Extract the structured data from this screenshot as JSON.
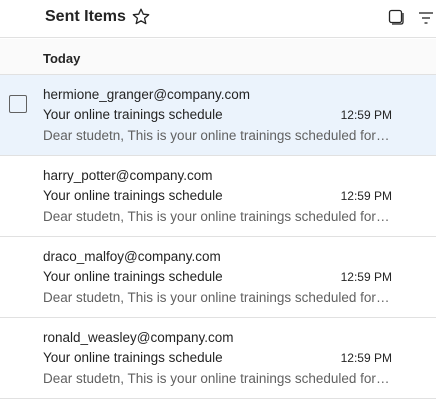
{
  "header": {
    "title": "Sent Items",
    "favorite_icon": "star-outline-icon",
    "select_icon": "select-mode-icon",
    "filter_icon": "filter-icon"
  },
  "group": {
    "label": "Today"
  },
  "colors": {
    "selected_background": "#ebf3fc",
    "preview_text": "#616161",
    "divider": "#e1e1e1"
  },
  "messages": [
    {
      "sender": "hermione_granger@company.com",
      "subject": "Your online trainings schedule",
      "time": "12:59 PM",
      "preview": "Dear studetn, This is your online trainings scheduled for today",
      "selected": true
    },
    {
      "sender": "harry_potter@company.com",
      "subject": "Your online trainings schedule",
      "time": "12:59 PM",
      "preview": "Dear studetn, This is your online trainings scheduled for today",
      "selected": false
    },
    {
      "sender": "draco_malfoy@company.com",
      "subject": "Your online trainings schedule",
      "time": "12:59 PM",
      "preview": "Dear studetn, This is your online trainings scheduled for today",
      "selected": false
    },
    {
      "sender": "ronald_weasley@company.com",
      "subject": "Your online trainings schedule",
      "time": "12:59 PM",
      "preview": "Dear studetn, This is your online trainings scheduled for today",
      "selected": false
    }
  ]
}
